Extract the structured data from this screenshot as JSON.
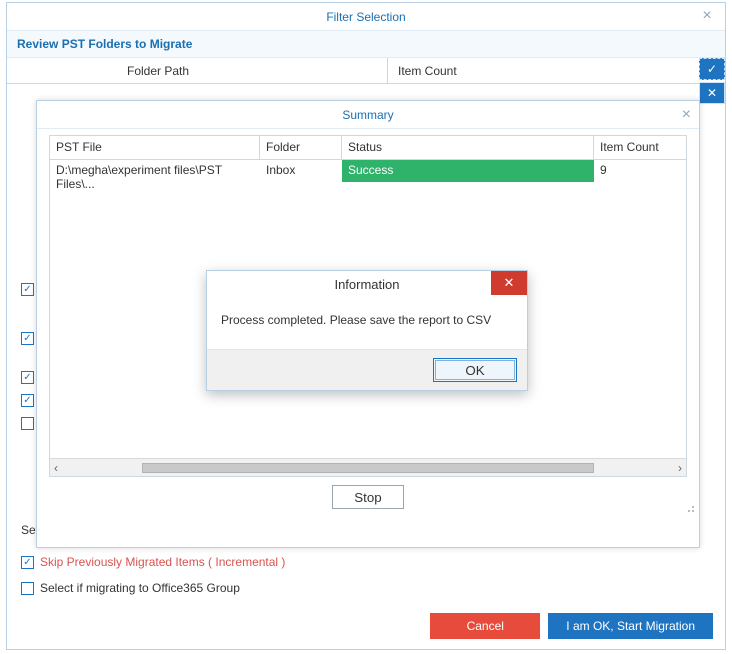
{
  "outer": {
    "title": "Filter Selection",
    "review_label": "Review PST Folders to Migrate",
    "col_folder_path": "Folder Path",
    "col_item_count": "Item Count",
    "set_label": "Set",
    "skip_label": "Skip Previously Migrated Items ( Incremental )",
    "office_label": "Select if migrating to Office365 Group",
    "cancel_label": "Cancel",
    "start_label": "I am OK, Start Migration"
  },
  "summary": {
    "title": "Summary",
    "col_pst": "PST File",
    "col_folder": "Folder",
    "col_status": "Status",
    "col_count": "Item Count",
    "rows": [
      {
        "pst": "D:\\megha\\experiment files\\PST Files\\...",
        "folder": "Inbox",
        "status": "Success",
        "count": "9"
      }
    ],
    "stop_label": "Stop"
  },
  "info": {
    "title": "Information",
    "message": "Process completed. Please save the report to CSV",
    "ok_label": "OK"
  }
}
